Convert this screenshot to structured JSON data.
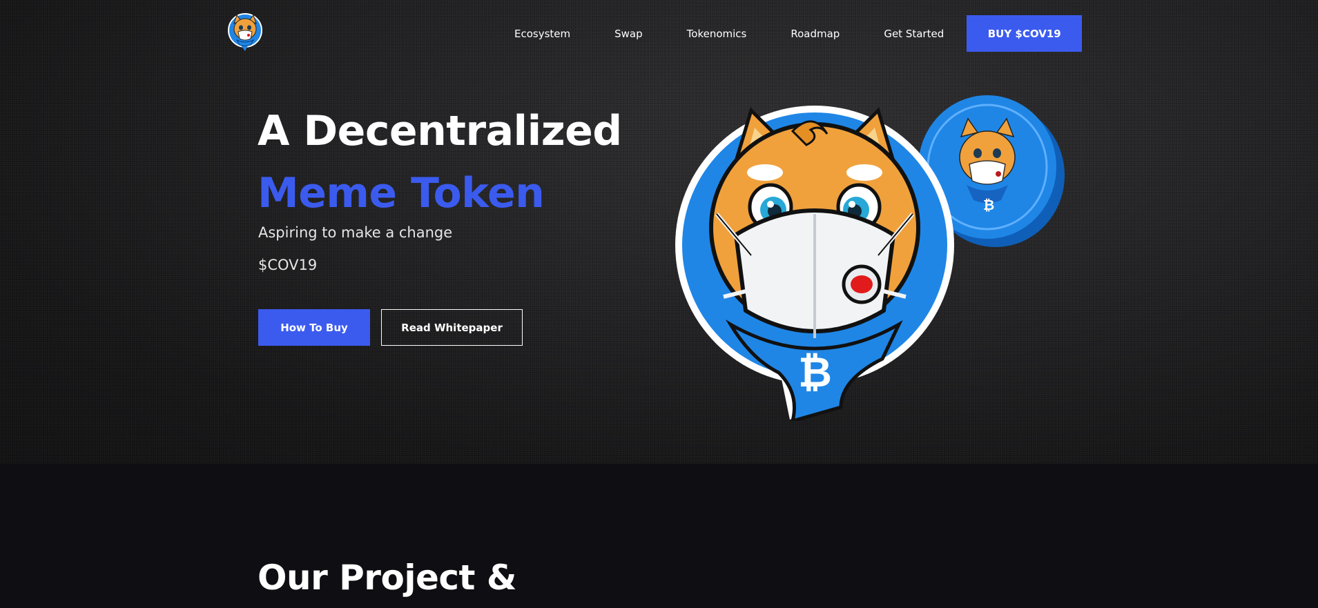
{
  "nav": {
    "links": [
      "Ecosystem",
      "Swap",
      "Tokenomics",
      "Roadmap",
      "Get Started"
    ],
    "cta_label": "BUY $COV19"
  },
  "hero": {
    "headline": "A Decentralized",
    "headline_accent": "Meme Token",
    "tagline": "Aspiring to make a change",
    "ticker": "$COV19",
    "primary_button": "How To Buy",
    "secondary_button": "Read Whitepaper"
  },
  "section": {
    "title": "Our Project &"
  },
  "colors": {
    "accent": "#3b5bef",
    "hero_bg": "#222224",
    "section_bg": "#0e0e13",
    "mascot_blue": "#1f86e6",
    "mascot_orange": "#f0a13c"
  },
  "icons": {
    "logo": "shiba-mascot-logo",
    "mascot": "shiba-mascot-illustration",
    "coin": "cov19-coin",
    "bitcoin": "bitcoin-icon"
  }
}
